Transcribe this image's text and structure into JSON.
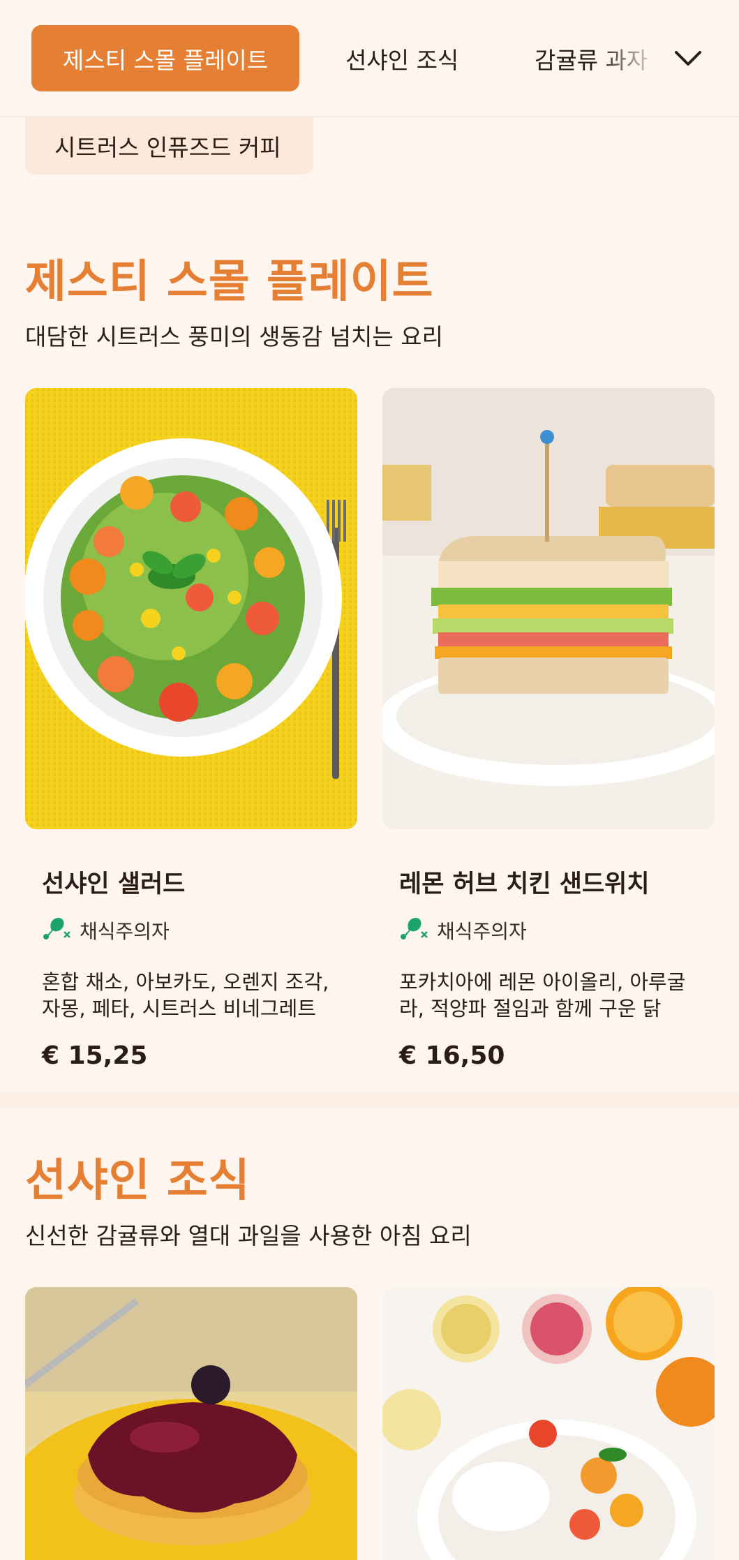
{
  "nav": {
    "tabs": [
      {
        "label": "제스티 스몰 플레이트"
      },
      {
        "label": "선샤인 조식"
      },
      {
        "label": "감귤류 과자"
      }
    ],
    "sub_tab": "시트러스 인퓨즈드 커피",
    "active_color": "#e57f33"
  },
  "sections": [
    {
      "title": "제스티 스몰 플레이트",
      "subtitle": "대담한 시트러스 풍미의 생동감 넘치는 요리",
      "items": [
        {
          "name": "선샤인 샐러드",
          "tag": "채식주의자",
          "tag_icon": "vegetarian-drumstick-crossed-icon",
          "description": "혼합 채소, 아보카도, 오렌지 조각, 자몽, 페타, 시트러스 비네그레트",
          "price": "€ 15,25",
          "image": "salad-bowl-photo"
        },
        {
          "name": "레몬 허브 치킨 샌드위치",
          "tag": "채식주의자",
          "tag_icon": "vegetarian-drumstick-crossed-icon",
          "description": "포카치아에 레몬 아이올리, 아루굴라, 적양파 절임과 함께 구운 닭고...",
          "price": "€ 16,50",
          "image": "sandwich-photo"
        }
      ]
    },
    {
      "title": "선샤인 조식",
      "subtitle": "신선한 감귤류와 열대 과일을 사용한 아침 요리",
      "items": [
        {
          "image": "pancake-photo"
        },
        {
          "image": "citrus-yogurt-bowl-photo"
        }
      ]
    }
  ],
  "colors": {
    "background": "#fdf5ee",
    "accent": "#e57f33",
    "tag_icon": "#1aa36b"
  }
}
